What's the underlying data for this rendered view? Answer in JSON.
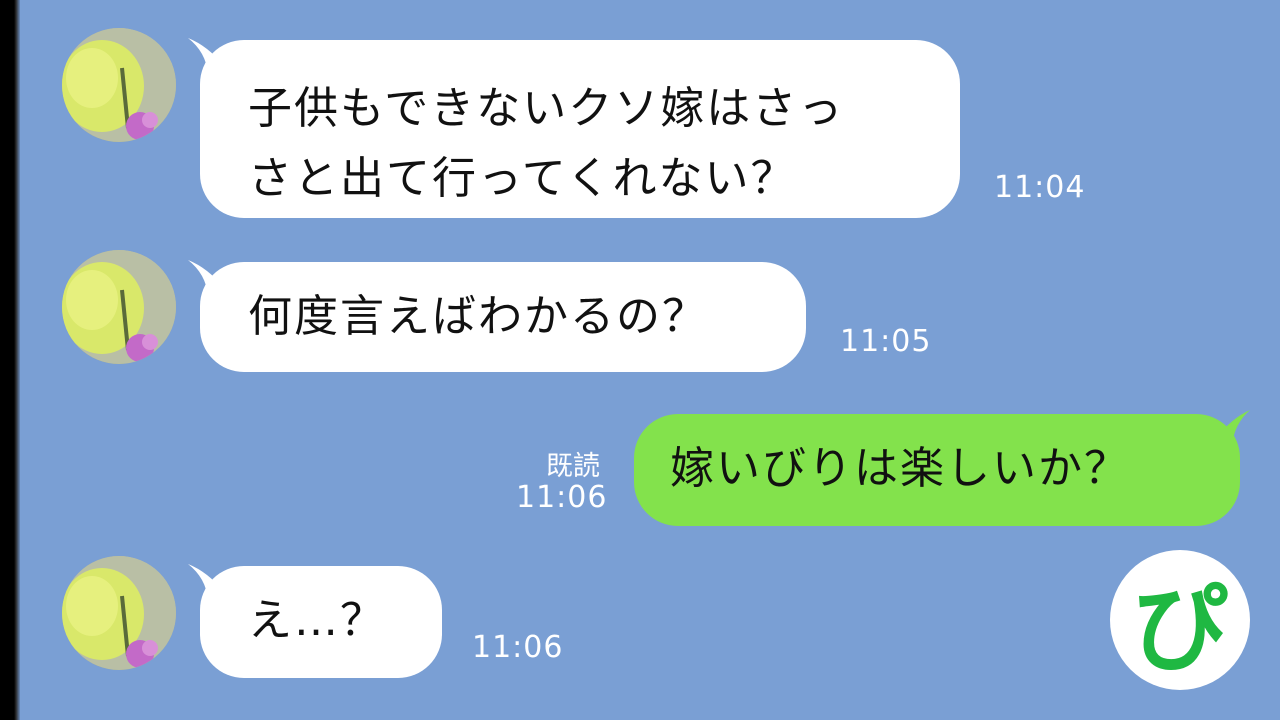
{
  "messages": [
    {
      "sender": "other",
      "lines": [
        "子供もできないクソ嫁はさっ",
        "さと出て行ってくれない？"
      ],
      "time": "11:04"
    },
    {
      "sender": "other",
      "lines": [
        "何度言えばわかるの？"
      ],
      "time": "11:05"
    },
    {
      "sender": "self",
      "lines": [
        "嫁いびりは楽しいか？"
      ],
      "time": "11:06",
      "read_label": "既読"
    },
    {
      "sender": "other",
      "lines": [
        "え…？"
      ],
      "time": "11:06"
    }
  ],
  "logo": {
    "text": "ぴ",
    "icon": "channel-logo-icon"
  },
  "colors": {
    "background": "#7a9fd4",
    "incoming_bubble": "#ffffff",
    "outgoing_bubble": "#83e24c",
    "logo_accent": "#1fb842"
  }
}
